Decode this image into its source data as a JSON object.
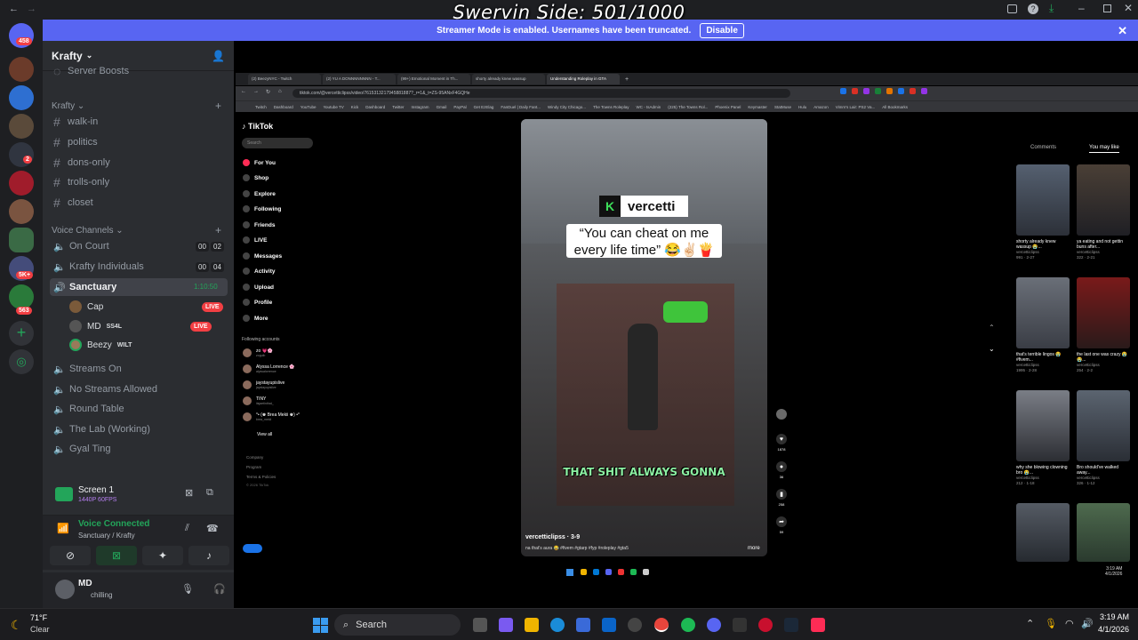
{
  "overlay": {
    "title": "Swervin Side: 501/1000"
  },
  "streamer_mode": {
    "message": "Streamer Mode is enabled. Usernames have been truncated.",
    "button": "Disable",
    "close": "✕"
  },
  "rail_badges": {
    "top": "458",
    "five_k": "5K+",
    "bottom": "563",
    "small": "2"
  },
  "server": {
    "name": "Krafty",
    "server_boosts": "Server Boosts"
  },
  "categories": {
    "text": "Krafty",
    "voice": "Voice Channels"
  },
  "text_channels": [
    "walk-in",
    "politics",
    "dons-only",
    "trolls-only",
    "closet"
  ],
  "voice_channels": [
    {
      "name": "On Court",
      "c1": "00",
      "c2": "02"
    },
    {
      "name": "Krafty Individuals",
      "c1": "00",
      "c2": "04"
    },
    {
      "name": "Sanctuary",
      "timer": "1:10:50"
    },
    {
      "name": "Streams On"
    },
    {
      "name": "No Streams Allowed"
    },
    {
      "name": "Round Table"
    },
    {
      "name": "The Lab (Working)"
    },
    {
      "name": "Gyal Ting"
    }
  ],
  "voice_users": [
    {
      "name": "Cap",
      "live": "LIVE"
    },
    {
      "name": "MD",
      "tag": "SS4L",
      "live": "LIVE"
    },
    {
      "name": "Beezy",
      "tag": "WILT"
    }
  ],
  "screen_share": {
    "title": "Screen 1",
    "quality": "1440P 60FPS"
  },
  "voice": {
    "status": "Voice Connected",
    "location": "Sanctuary / Krafty"
  },
  "user": {
    "name": "MD",
    "status": "chilling"
  },
  "browser": {
    "tabs": [
      "(2) BeezyNYC - Twitch",
      "(2) YU A DONNNNNNNN - T...",
      "(99+) Emotional Moment in Th...",
      "shorty already knew wassup",
      "Understanding Roleplay in GTA"
    ],
    "url": "tiktok.com/@vercetticlipss/video/7615313217945881887?_r=1&_t=ZS-95ANxF4GQHe",
    "bookmarks": [
      "Twitch",
      "Dashboard",
      "YouTube",
      "Youtube TV",
      "Kick",
      "Dashboard",
      "Twitter",
      "Instagram",
      "Gmail",
      "PayPal",
      "Get EzElag",
      "FanDuel | Daily Fant...",
      "Windy City Chicago...",
      "The Towns Roleplay",
      "WC - tsAdmin",
      "(225) The Towns Rol...",
      "Phoenix Panel",
      "Keymaster",
      "StatMuse",
      "Hulu",
      "Amazon",
      "Vimm's Lair: PS2 Va...",
      "All Bookmarks"
    ]
  },
  "tiktok": {
    "logo": "TikTok",
    "search": "Search",
    "nav": [
      "For You",
      "Shop",
      "Explore",
      "Following",
      "Friends",
      "LIVE",
      "Messages",
      "Activity",
      "Upload",
      "Profile",
      "More"
    ],
    "following_title": "Following accounts",
    "following": [
      {
        "name": "zo 💗🌸",
        "handle": "zoguib"
      },
      {
        "name": "Alyssa Lorrence 🌸",
        "handle": "alyssalorrence"
      },
      {
        "name": "jaystayupislive",
        "handle": "jaystayupislive"
      },
      {
        "name": "TINY",
        "handle": "itsjaetinthat_"
      },
      {
        "name": "°• (♚ Brea Mekii ♚) •°",
        "handle": "brea_mekii"
      }
    ],
    "view_all": "View all",
    "footer": [
      "Company",
      "Program",
      "Terms & Policies",
      "© 2026 TikTok"
    ],
    "video": {
      "brand": "vercetti",
      "caption_line1": "“You can cheat on me",
      "caption_line2": "every life time” 😂✌🏻🍟",
      "subtitle": "THAT SHIT ALWAYS GONNA",
      "author": "vercetticlipss · 3-9",
      "desc": "na that's aura 😂 #fivem #gtarp #fyp #roleplay #gta5",
      "more": "more"
    },
    "actions": [
      {
        "icon": "♥",
        "count": "1878"
      },
      {
        "icon": "●",
        "count": "36"
      },
      {
        "icon": "▮",
        "count": "258"
      },
      {
        "icon": "➦",
        "count": "59"
      }
    ],
    "right_tabs": [
      "Comments",
      "You may like"
    ],
    "recs": [
      {
        "title": "shorty already knew wassup 😭...",
        "author": "vercetticlipss",
        "stats": "991 · 2-27"
      },
      {
        "title": "ya eating and not gettin buns after...",
        "author": "vercetticlipss",
        "stats": "322 · 2-21"
      },
      {
        "title": "that's terrible lingos 😭 #fivem...",
        "author": "vercetticlipss",
        "stats": "1995 · 2-28"
      },
      {
        "title": "the last one was crazy 😭😭...",
        "author": "vercetticlipss",
        "stats": "254 · 2-2"
      },
      {
        "title": "why she blowing clowning bro 😭...",
        "author": "vercetticlipss",
        "stats": "212 · 1-18"
      },
      {
        "title": "Bro should've walked away...",
        "author": "vercetticlipss",
        "stats": "326 · 1-12"
      },
      {
        "title": "",
        "author": "",
        "stats": ""
      },
      {
        "title": "",
        "author": "",
        "stats": ""
      }
    ]
  },
  "taskbar": {
    "search": "Search",
    "weather_temp": "71°F",
    "weather_desc": "Clear",
    "time": "3:19 AM",
    "date": "4/1/2026",
    "inner_time": "3:19 AM",
    "inner_date": "4/1/2026"
  },
  "colors": {
    "discord_blurple": "#5865f2",
    "voice_green": "#23a55a",
    "live_red": "#f23f43",
    "tiktok_bg": "#000000"
  }
}
